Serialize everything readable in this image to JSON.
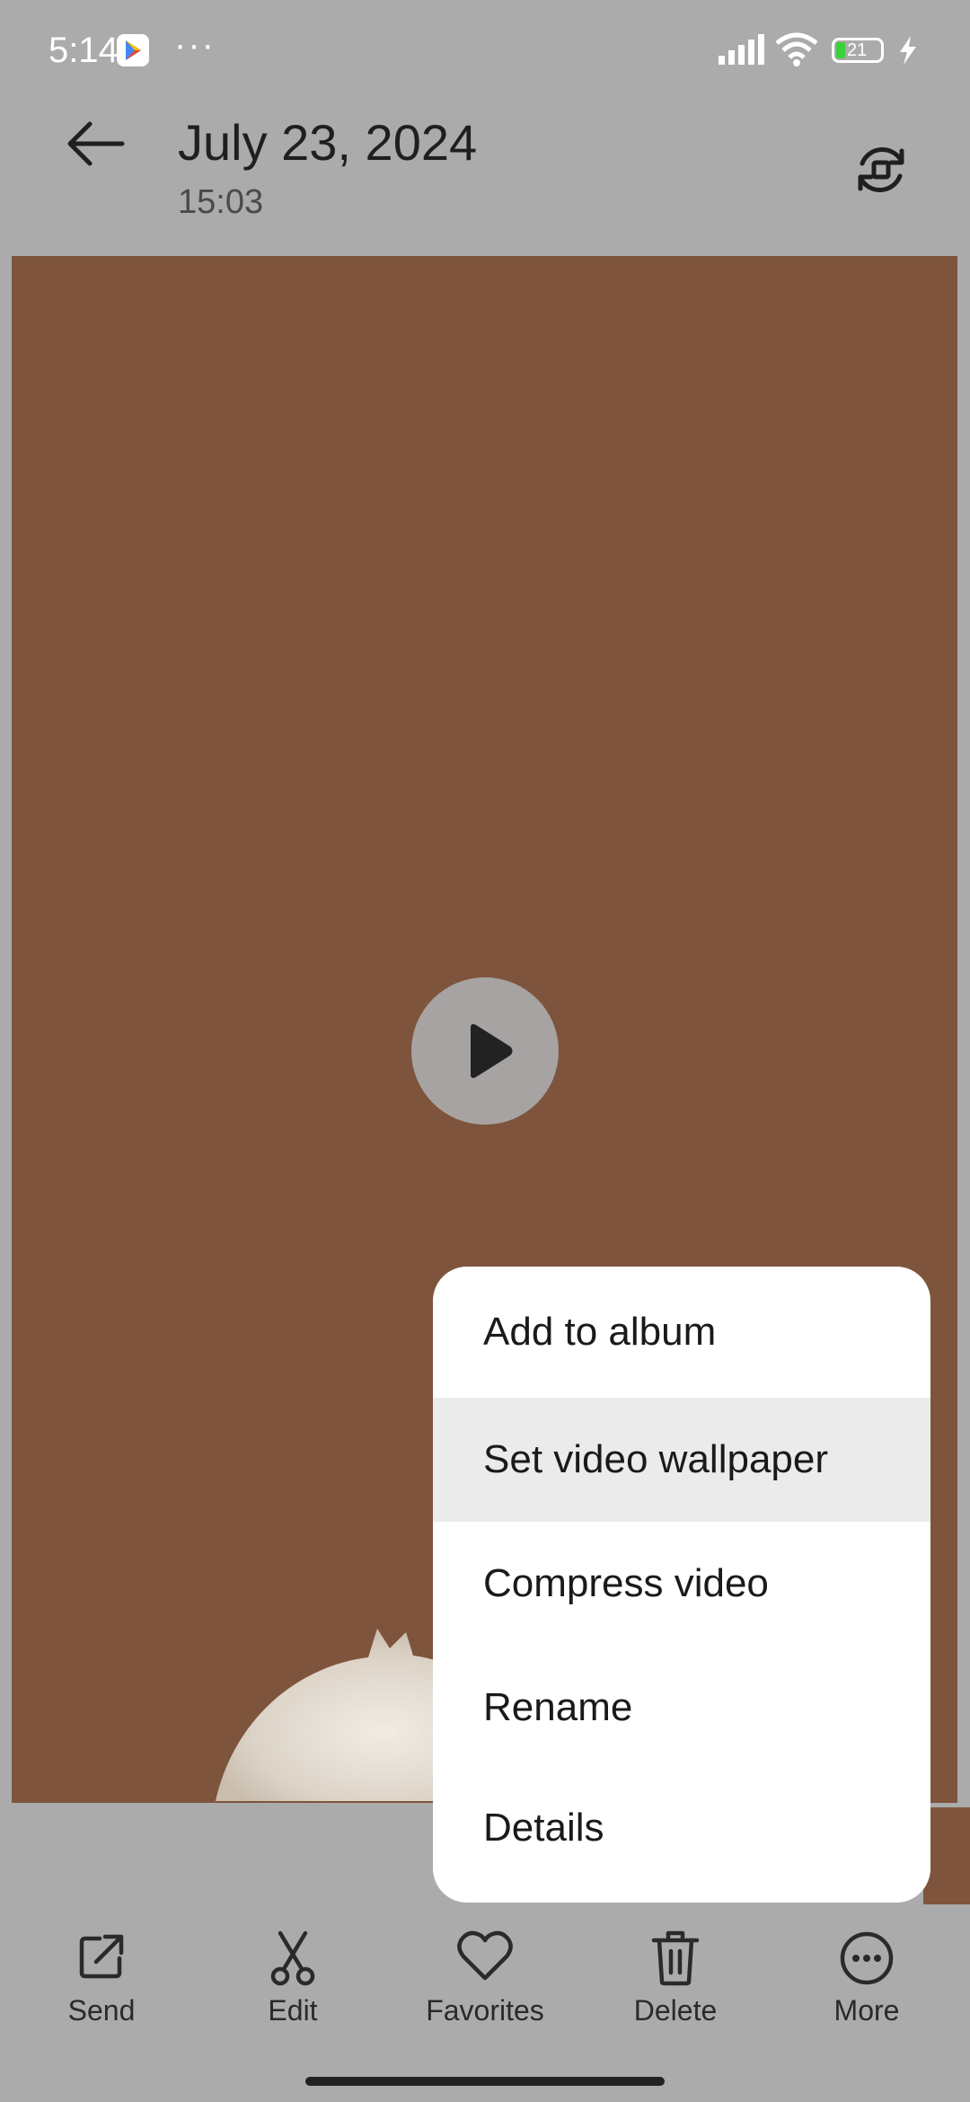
{
  "status_bar": {
    "time": "5:14",
    "battery_level": "21",
    "app_badge_icon": "google-play-icon",
    "overflow_icon": "dots-icon"
  },
  "header": {
    "title": "July 23, 2024",
    "subtitle": "15:03",
    "back_icon": "arrow-left-icon",
    "rotate_icon": "rotate-icon"
  },
  "media": {
    "background_color": "#7e553c",
    "play_icon": "play-icon"
  },
  "menu": {
    "items": [
      {
        "label": "Add to album"
      },
      {
        "label": "Set video wallpaper",
        "selected": true
      },
      {
        "label": "Compress video"
      },
      {
        "label": "Rename"
      },
      {
        "label": "Details"
      }
    ]
  },
  "toolbar": {
    "items": [
      {
        "label": "Send",
        "icon": "share-icon"
      },
      {
        "label": "Edit",
        "icon": "scissors-icon"
      },
      {
        "label": "Favorites",
        "icon": "heart-icon"
      },
      {
        "label": "Delete",
        "icon": "trash-icon"
      },
      {
        "label": "More",
        "icon": "more-circle-icon"
      }
    ]
  },
  "colors": {
    "dim_overlay": "#ababab",
    "menu_background": "#ffffff",
    "menu_selected": "#ebebeb"
  }
}
